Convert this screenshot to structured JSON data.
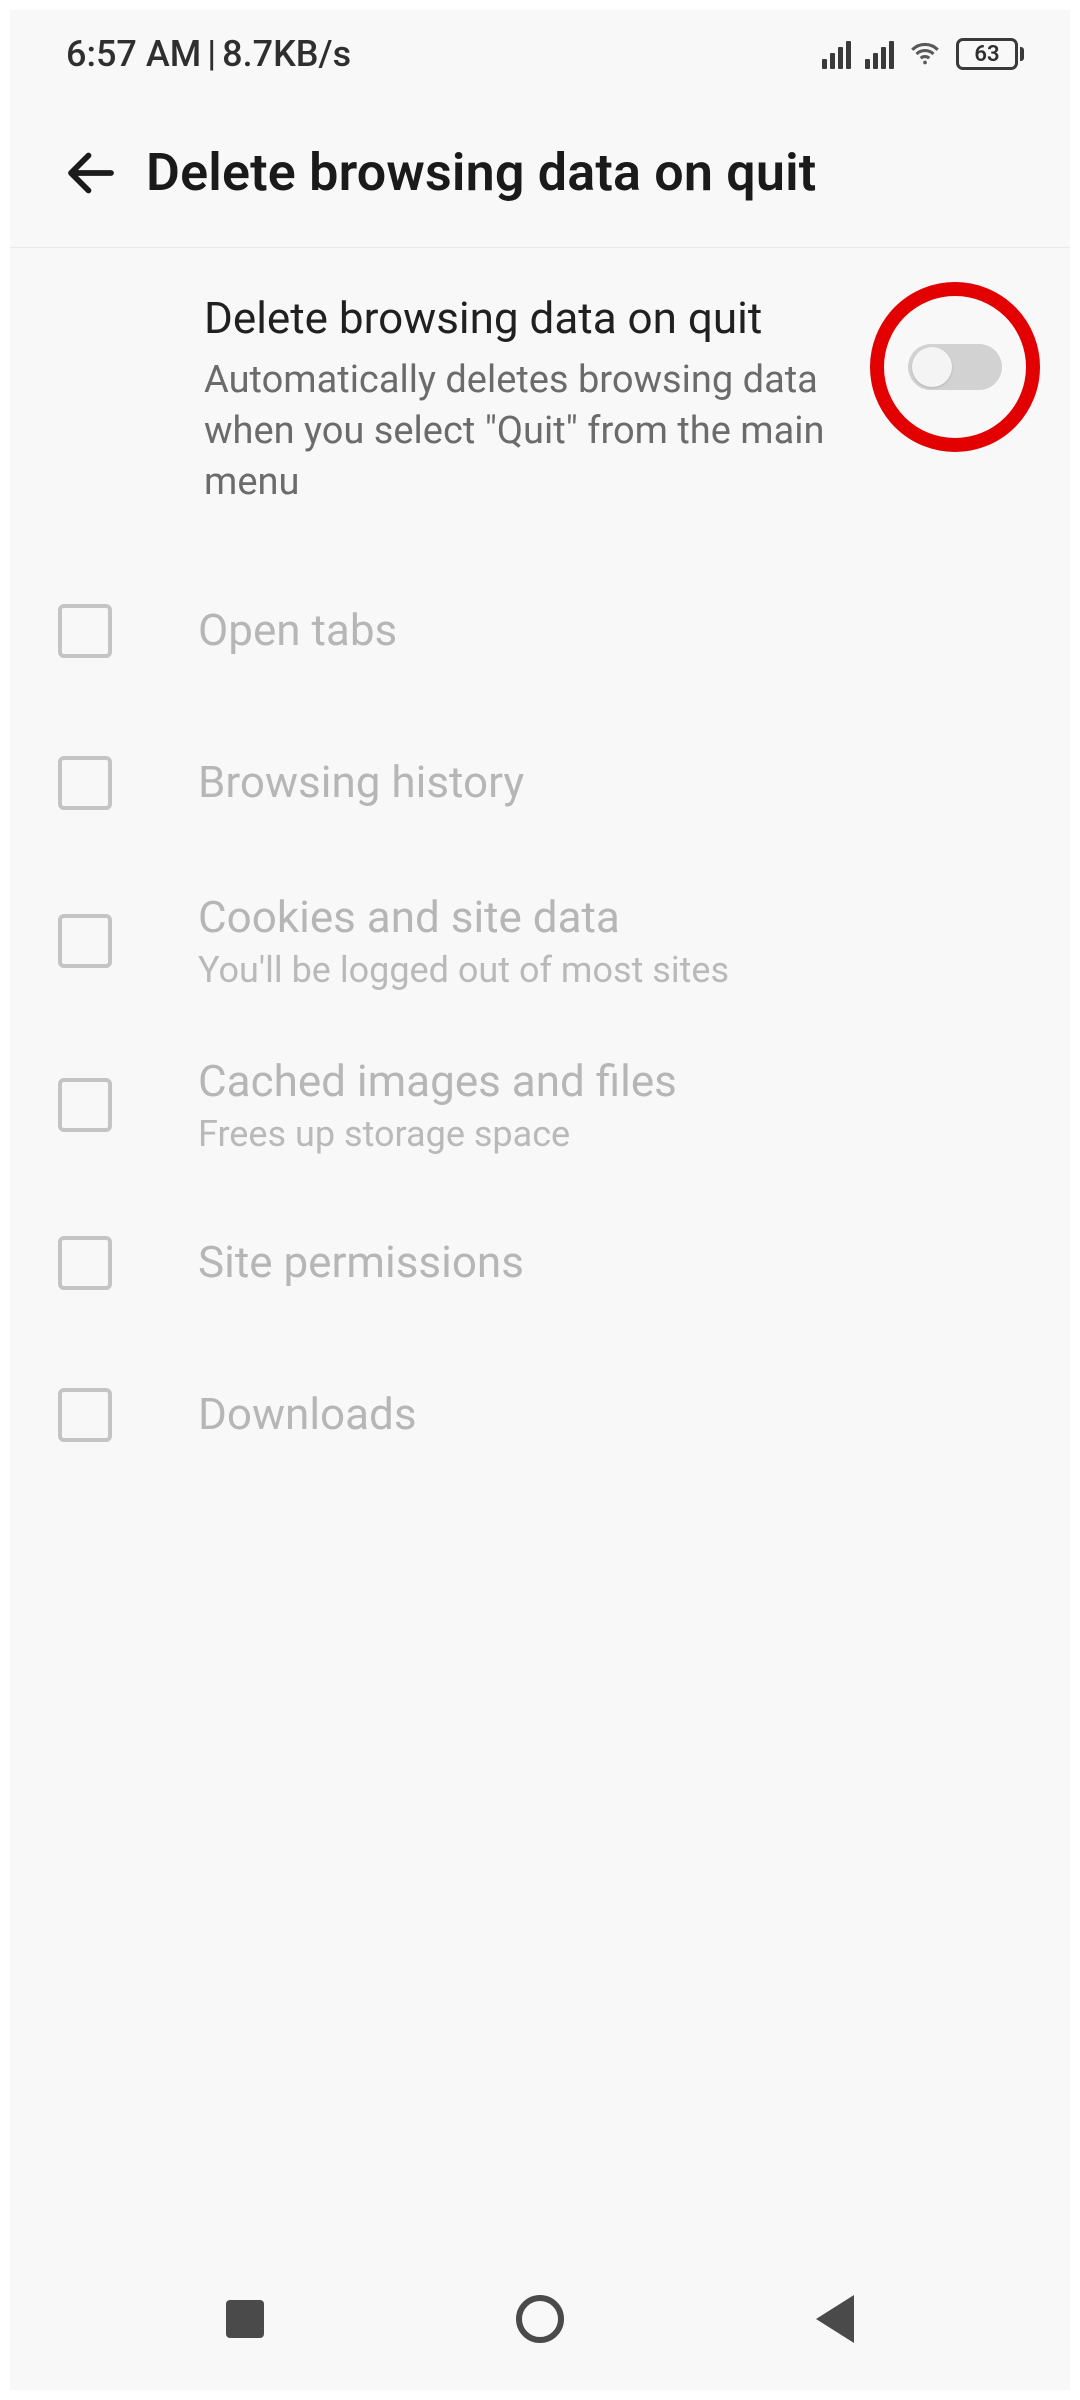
{
  "status": {
    "time": "6:57 AM",
    "separator": "|",
    "net_speed": "8.7KB/s",
    "battery_pct": "63"
  },
  "header": {
    "title": "Delete browsing data on quit"
  },
  "main_toggle": {
    "title": "Delete browsing data on quit",
    "subtitle": "Automatically deletes browsing data when you select \"Quit\" from the main menu",
    "enabled": false
  },
  "options": [
    {
      "key": "open-tabs",
      "label": "Open tabs",
      "sub": ""
    },
    {
      "key": "browsing-history",
      "label": "Browsing history",
      "sub": ""
    },
    {
      "key": "cookies",
      "label": "Cookies and site data",
      "sub": "You'll be logged out of most sites"
    },
    {
      "key": "cached",
      "label": "Cached images and files",
      "sub": "Frees up storage space"
    },
    {
      "key": "site-permissions",
      "label": "Site permissions",
      "sub": ""
    },
    {
      "key": "downloads",
      "label": "Downloads",
      "sub": ""
    }
  ]
}
